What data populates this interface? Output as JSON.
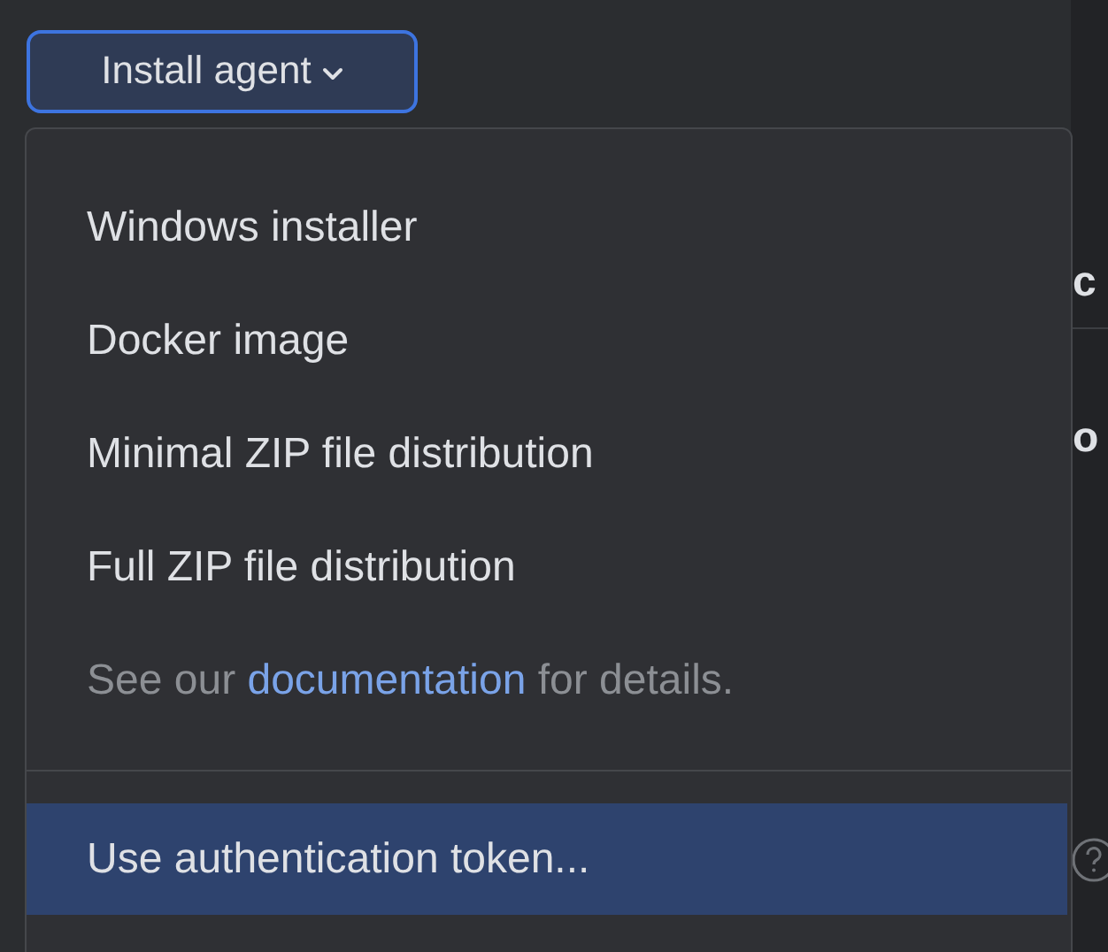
{
  "install_button": {
    "label": "Install agent",
    "expanded": true
  },
  "menu": {
    "items": [
      {
        "label": "Windows installer",
        "selected": false
      },
      {
        "label": "Docker image",
        "selected": false
      },
      {
        "label": "Minimal ZIP file distribution",
        "selected": false
      },
      {
        "label": "Full ZIP file distribution",
        "selected": false
      }
    ],
    "note": {
      "before": "See our ",
      "link": "documentation",
      "after": " for details."
    },
    "footer_items": [
      {
        "label": "Use authentication token...",
        "selected": true
      }
    ]
  },
  "background": {
    "texts": [
      "c",
      "o"
    ]
  }
}
